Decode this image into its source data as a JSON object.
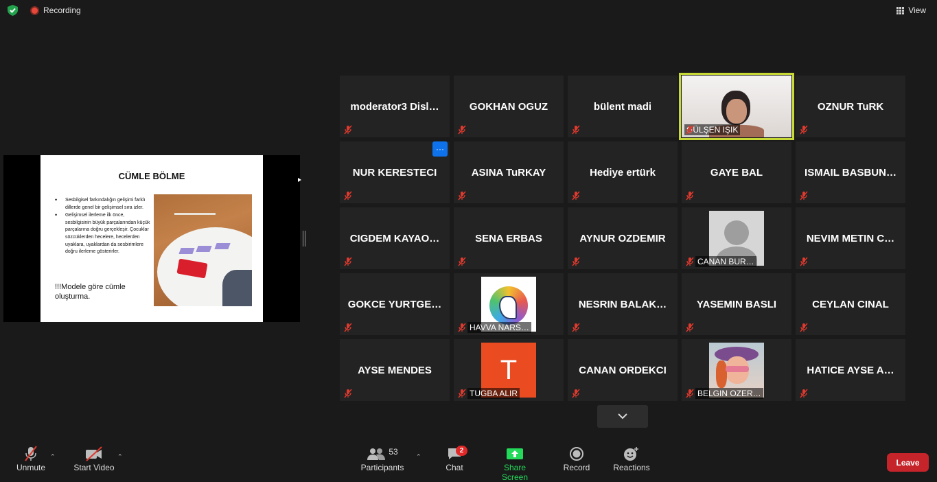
{
  "topbar": {
    "recording_label": "Recording",
    "view_label": "View"
  },
  "shared_slide": {
    "title": "CÜMLE BÖLME",
    "bullets": [
      "Sesbilgisel farkındalığın gelişimi farklı dillerde genel bir gelişimsel sıra izler.",
      "Gelişimsel ilerleme ilk önce, sesbilgisinin büyük parçalarından küçük parçalarına doğru gerçekleşir. Çocuklar sözcüklerden hecelere, hecelerden uyaklara, uyaklardan da sesbirimlere doğru ilerleme gösterirler."
    ],
    "subtitle": "!!!Modele göre cümle oluşturma."
  },
  "participants": [
    {
      "name": "moderator3  Disl…",
      "kind": "name"
    },
    {
      "name": "GOKHAN OGUZ",
      "kind": "name"
    },
    {
      "name": "bülent madi",
      "kind": "name"
    },
    {
      "name": "GÜLŞEN IŞIK",
      "kind": "video",
      "active": true
    },
    {
      "name": "OZNUR TuRK",
      "kind": "name"
    },
    {
      "name": "NUR KERESTECI",
      "kind": "name",
      "menu": "···"
    },
    {
      "name": "ASINA TuRKAY",
      "kind": "name"
    },
    {
      "name": "Hediye ertürk",
      "kind": "name"
    },
    {
      "name": "GAYE BAL",
      "kind": "name"
    },
    {
      "name": "ISMAIL BASBUN…",
      "kind": "name"
    },
    {
      "name": "CIGDEM KAYAO…",
      "kind": "name"
    },
    {
      "name": "SENA ERBAS",
      "kind": "name"
    },
    {
      "name": "AYNUR OZDEMIR",
      "kind": "name"
    },
    {
      "name": "CANAN BUR…",
      "kind": "avatar-default"
    },
    {
      "name": "NEVIM METIN C…",
      "kind": "name"
    },
    {
      "name": "GOKCE YURTGE…",
      "kind": "name"
    },
    {
      "name": "HAVVA NARS…",
      "kind": "avatar-unicorn"
    },
    {
      "name": "NESRIN BALAK…",
      "kind": "name"
    },
    {
      "name": "YASEMIN BASLI",
      "kind": "name"
    },
    {
      "name": "CEYLAN CINAL",
      "kind": "name"
    },
    {
      "name": "AYSE MENDES",
      "kind": "name"
    },
    {
      "name": "TUGBA ALIR",
      "kind": "avatar-letter",
      "letter": "T"
    },
    {
      "name": "CANAN ORDEKCI",
      "kind": "name"
    },
    {
      "name": "BELGIN OZER…",
      "kind": "avatar-photo"
    },
    {
      "name": "HATICE AYSE A…",
      "kind": "name"
    }
  ],
  "toolbar": {
    "unmute_label": "Unmute",
    "start_video_label": "Start Video",
    "participants_label": "Participants",
    "participants_count": "53",
    "chat_label": "Chat",
    "chat_badge": "2",
    "share_label": "Share Screen",
    "record_label": "Record",
    "reactions_label": "Reactions",
    "leave_label": "Leave"
  },
  "colors": {
    "active_speaker": "#c6d934",
    "share_green": "#23d959",
    "leave_red": "#c6242b",
    "muted_red": "#e0392d"
  }
}
